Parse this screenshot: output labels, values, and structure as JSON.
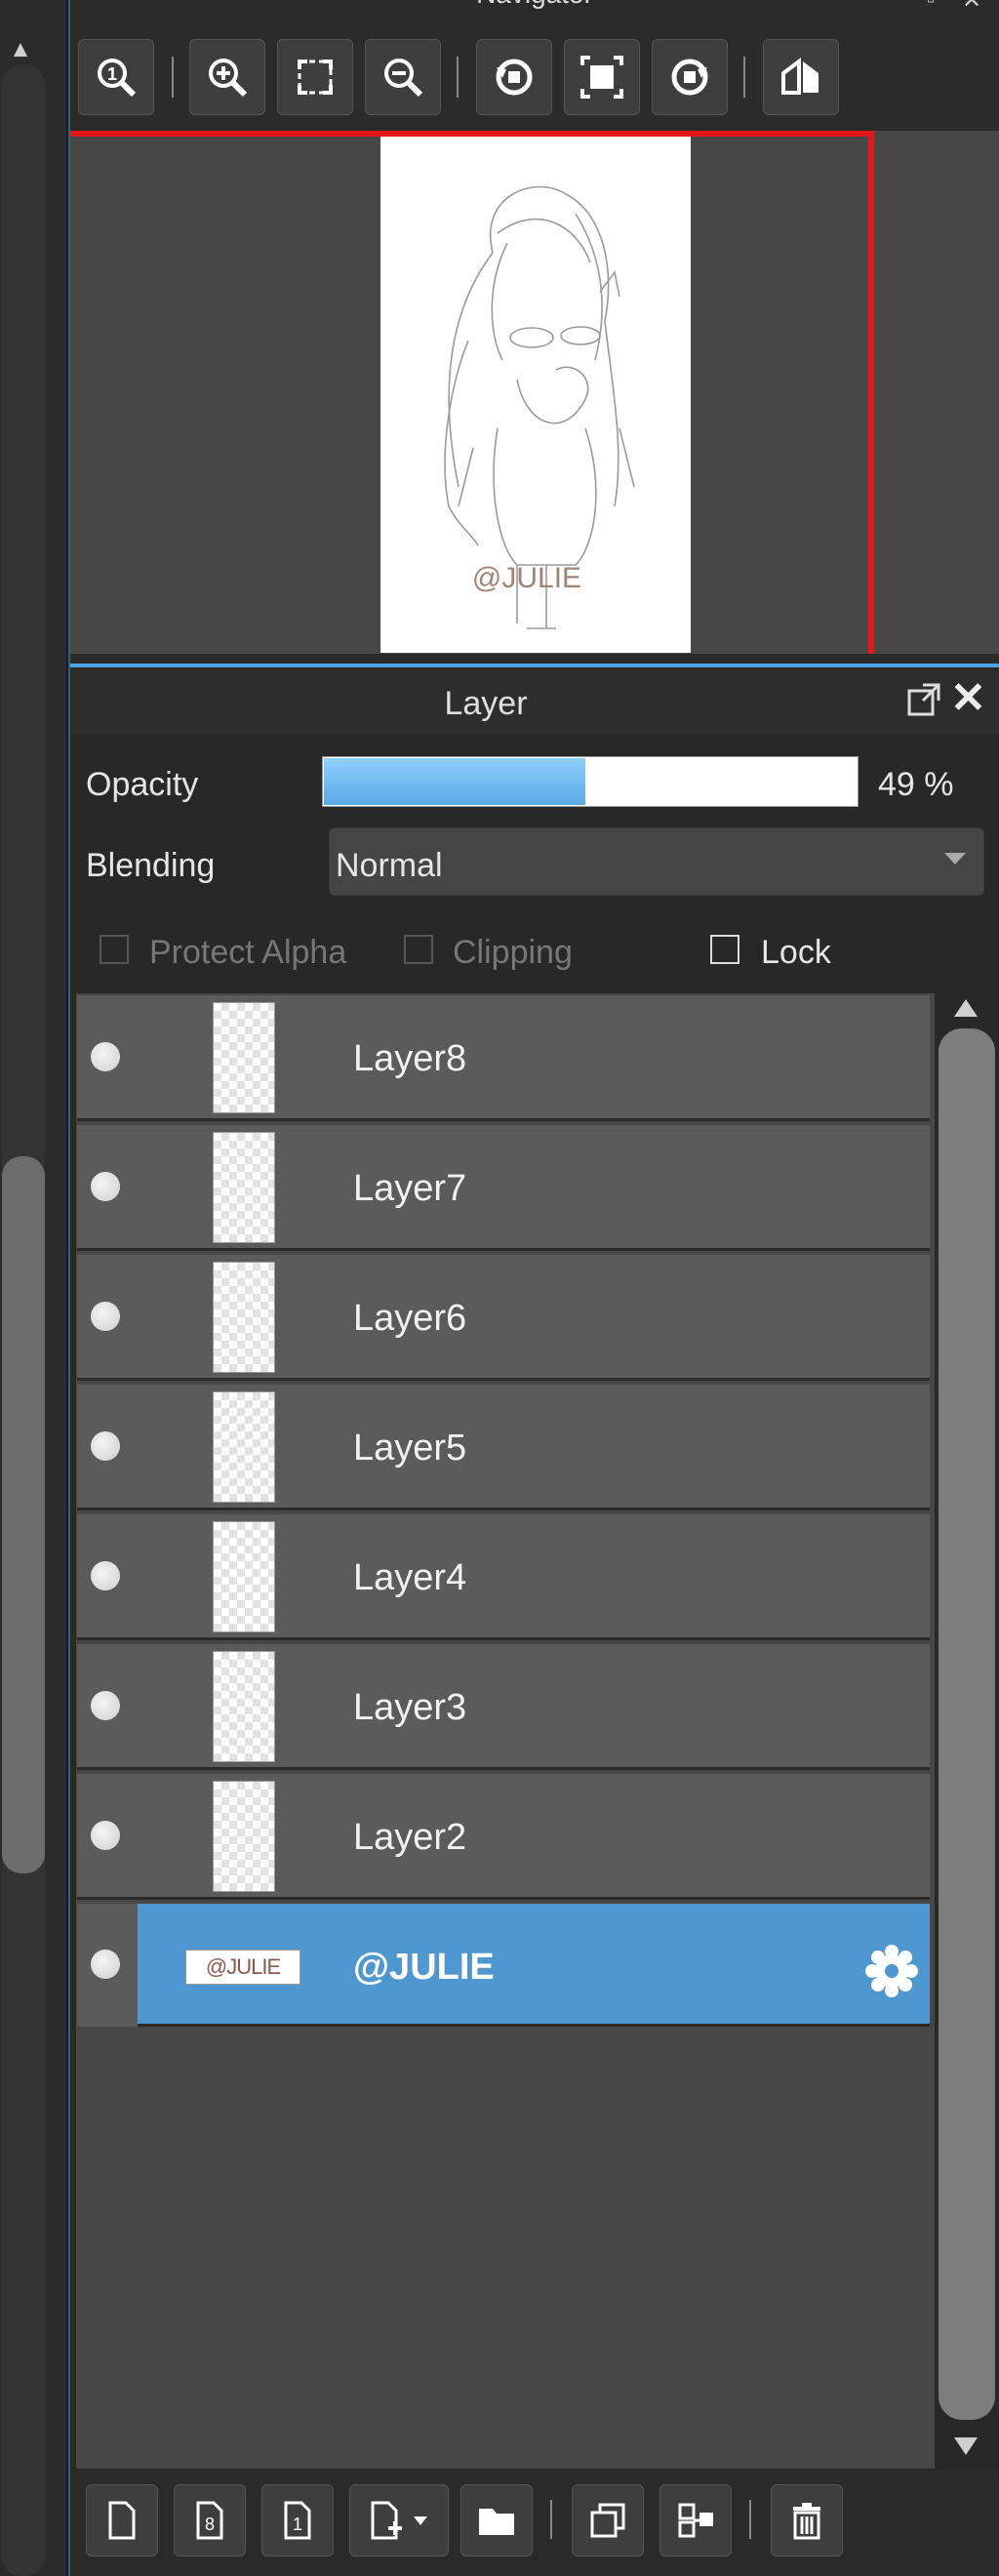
{
  "navigator": {
    "title": "Navigator",
    "canvas_watermark": "@JULIE",
    "tools": [
      "zoom-actual-icon",
      "zoom-in-icon",
      "fit-icon",
      "zoom-out-icon",
      "rotate-left-icon",
      "fullscreen-icon",
      "rotate-right-icon",
      "flip-icon"
    ]
  },
  "layer_panel": {
    "title": "Layer",
    "opacity_label": "Opacity",
    "opacity_value": "49 %",
    "opacity_fraction": 0.49,
    "blending_label": "Blending",
    "blending_value": "Normal",
    "protect_alpha_label": "Protect Alpha",
    "clipping_label": "Clipping",
    "lock_label": "Lock",
    "layers": [
      {
        "name": "Layer8",
        "selected": false
      },
      {
        "name": "Layer7",
        "selected": false
      },
      {
        "name": "Layer6",
        "selected": false
      },
      {
        "name": "Layer5",
        "selected": false
      },
      {
        "name": "Layer4",
        "selected": false
      },
      {
        "name": "Layer3",
        "selected": false
      },
      {
        "name": "Layer2",
        "selected": false
      },
      {
        "name": "@JULIE",
        "selected": true,
        "thumb_text": "@JULIE"
      }
    ]
  },
  "toolbar": {
    "buttons": [
      "new-layer-icon",
      "new-8bit-layer-icon",
      "new-1bit-layer-icon",
      "add-layer-menu-icon",
      "folder-icon",
      "duplicate-icon",
      "merge-icon",
      "delete-icon"
    ]
  },
  "colors": {
    "accent": "#4e97d1",
    "close_red": "#e21818",
    "opacity_fill": "#6bb7f0"
  }
}
